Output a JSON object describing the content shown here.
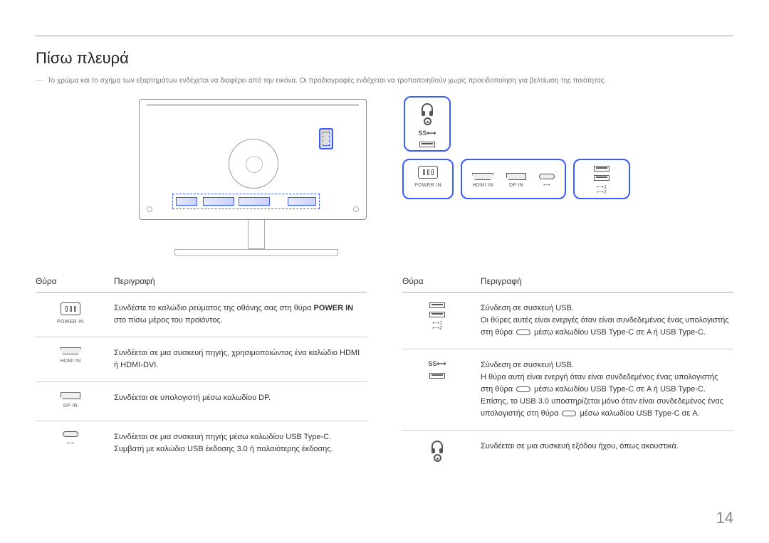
{
  "section": {
    "title": "Πίσω πλευρά",
    "disclaimer_prefix": "―",
    "disclaimer": "Το χρώμα και το σχήμα των εξαρτημάτων ενδέχεται να διαφέρει από την εικόνα. Οι προδιαγραφές ενδέχεται να τροποποιηθούν χωρίς προειδοποίηση για βελτίωση της ποιότητας."
  },
  "labels": {
    "power_in": "POWER IN",
    "hdmi_in": "HDMI IN",
    "dp_in": "DP IN",
    "usb_c_glyph": "⟷",
    "usb_ss": "SS⟷",
    "usb_1": "⟷1",
    "usb_2": "⟷2"
  },
  "table_headers": {
    "port": "Θύρα",
    "description": "Περιγραφή"
  },
  "left_rows": {
    "power": {
      "label": "POWER IN",
      "desc_a": "Συνδέστε το καλώδιο ρεύματος της οθόνης σας στη θύρα ",
      "desc_b": "POWER IN",
      "desc_c": " στο πίσω μέρος του προϊόντος."
    },
    "hdmi": {
      "label": "HDMI IN",
      "desc": "Συνδέεται σε μια συσκευή πηγής, χρησιμοποιώντας ένα καλώδιο HDMI ή HDMI-DVI."
    },
    "dp": {
      "label": "DP IN",
      "desc": "Συνδέεται σε υπολογιστή μέσω καλωδίου DP."
    },
    "usbc": {
      "desc": "Συνδέεται σε μια συσκευή πηγής μέσω καλωδίου USB Type-C. Συμβατή με καλώδιο USB έκδοσης 3.0 ή παλαιότερης έκδοσης."
    }
  },
  "right_rows": {
    "usb_a": {
      "line1": "Σύνδεση σε συσκευή USB.",
      "line2a": "Οι θύρες αυτές είναι ενεργές όταν είναι συνδεδεμένος ένας υπολογιστής στη θύρα ",
      "line2b": " μέσω καλωδίου USB Type-C σε A ή USB Type-C."
    },
    "usb_ss": {
      "line1": "Σύνδεση σε συσκευή USB.",
      "line2a": "Η θύρα αυτή είναι ενεργή όταν είναι συνδεδεμένος ένας υπολογιστής στη θύρα ",
      "line2b": " μέσω καλωδίου USB Type-C σε A ή USB Type-C. Επίσης, το USB 3.0 υποστηρίζεται μόνο όταν είναι συνδεδεμένος ένας υπολογιστής στη θύρα ",
      "line2c": " μέσω καλωδίου USB Type-C σε A."
    },
    "audio": {
      "desc": "Συνδέεται σε μια συσκευή εξόδου ήχου, όπως ακουστικά."
    }
  },
  "page_number": "14"
}
